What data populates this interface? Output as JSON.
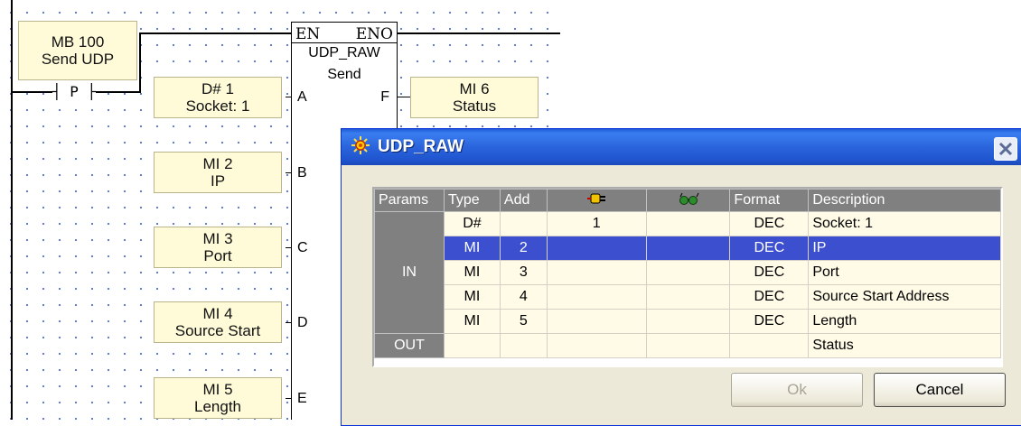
{
  "ladder": {
    "coils": [
      {
        "line1": "MB 100",
        "line2": "Send UDP"
      },
      {
        "line1": "D# 1",
        "line2": "Socket: 1"
      },
      {
        "line1": "MI 6",
        "line2": "Status"
      },
      {
        "line1": "MI 2",
        "line2": "IP"
      },
      {
        "line1": "MI 3",
        "line2": "Port"
      },
      {
        "line1": "MI 4",
        "line2": "Source Start"
      },
      {
        "line1": "MI 5",
        "line2": "Length"
      }
    ],
    "contact_label": "P",
    "function_block": {
      "en": "EN",
      "eno": "ENO",
      "name": "UDP_RAW",
      "op": "Send",
      "pins": [
        "A",
        "B",
        "C",
        "D",
        "E",
        "F"
      ]
    }
  },
  "dialog": {
    "title": "UDP_RAW",
    "close_label": "X",
    "columns": [
      "Params",
      "Type",
      "Add",
      "",
      "",
      "Format",
      "Description"
    ],
    "column_icons": [
      "plug-icon",
      "glasses-icon"
    ],
    "in_label": "IN",
    "out_label": "OUT",
    "rows": [
      {
        "type": "D#",
        "add": "",
        "value": "1",
        "watch": "",
        "format": "DEC",
        "description": "Socket: 1"
      },
      {
        "type": "MI",
        "add": "2",
        "value": "",
        "watch": "",
        "format": "DEC",
        "description": "IP"
      },
      {
        "type": "MI",
        "add": "3",
        "value": "",
        "watch": "",
        "format": "DEC",
        "description": "Port"
      },
      {
        "type": "MI",
        "add": "4",
        "value": "",
        "watch": "",
        "format": "DEC",
        "description": "Source Start Address"
      },
      {
        "type": "MI",
        "add": "5",
        "value": "",
        "watch": "",
        "format": "DEC",
        "description": "Length"
      },
      {
        "type": "",
        "add": "",
        "value": "",
        "watch": "",
        "format": "",
        "description": "Status"
      }
    ],
    "ok_label": "Ok",
    "cancel_label": "Cancel"
  }
}
